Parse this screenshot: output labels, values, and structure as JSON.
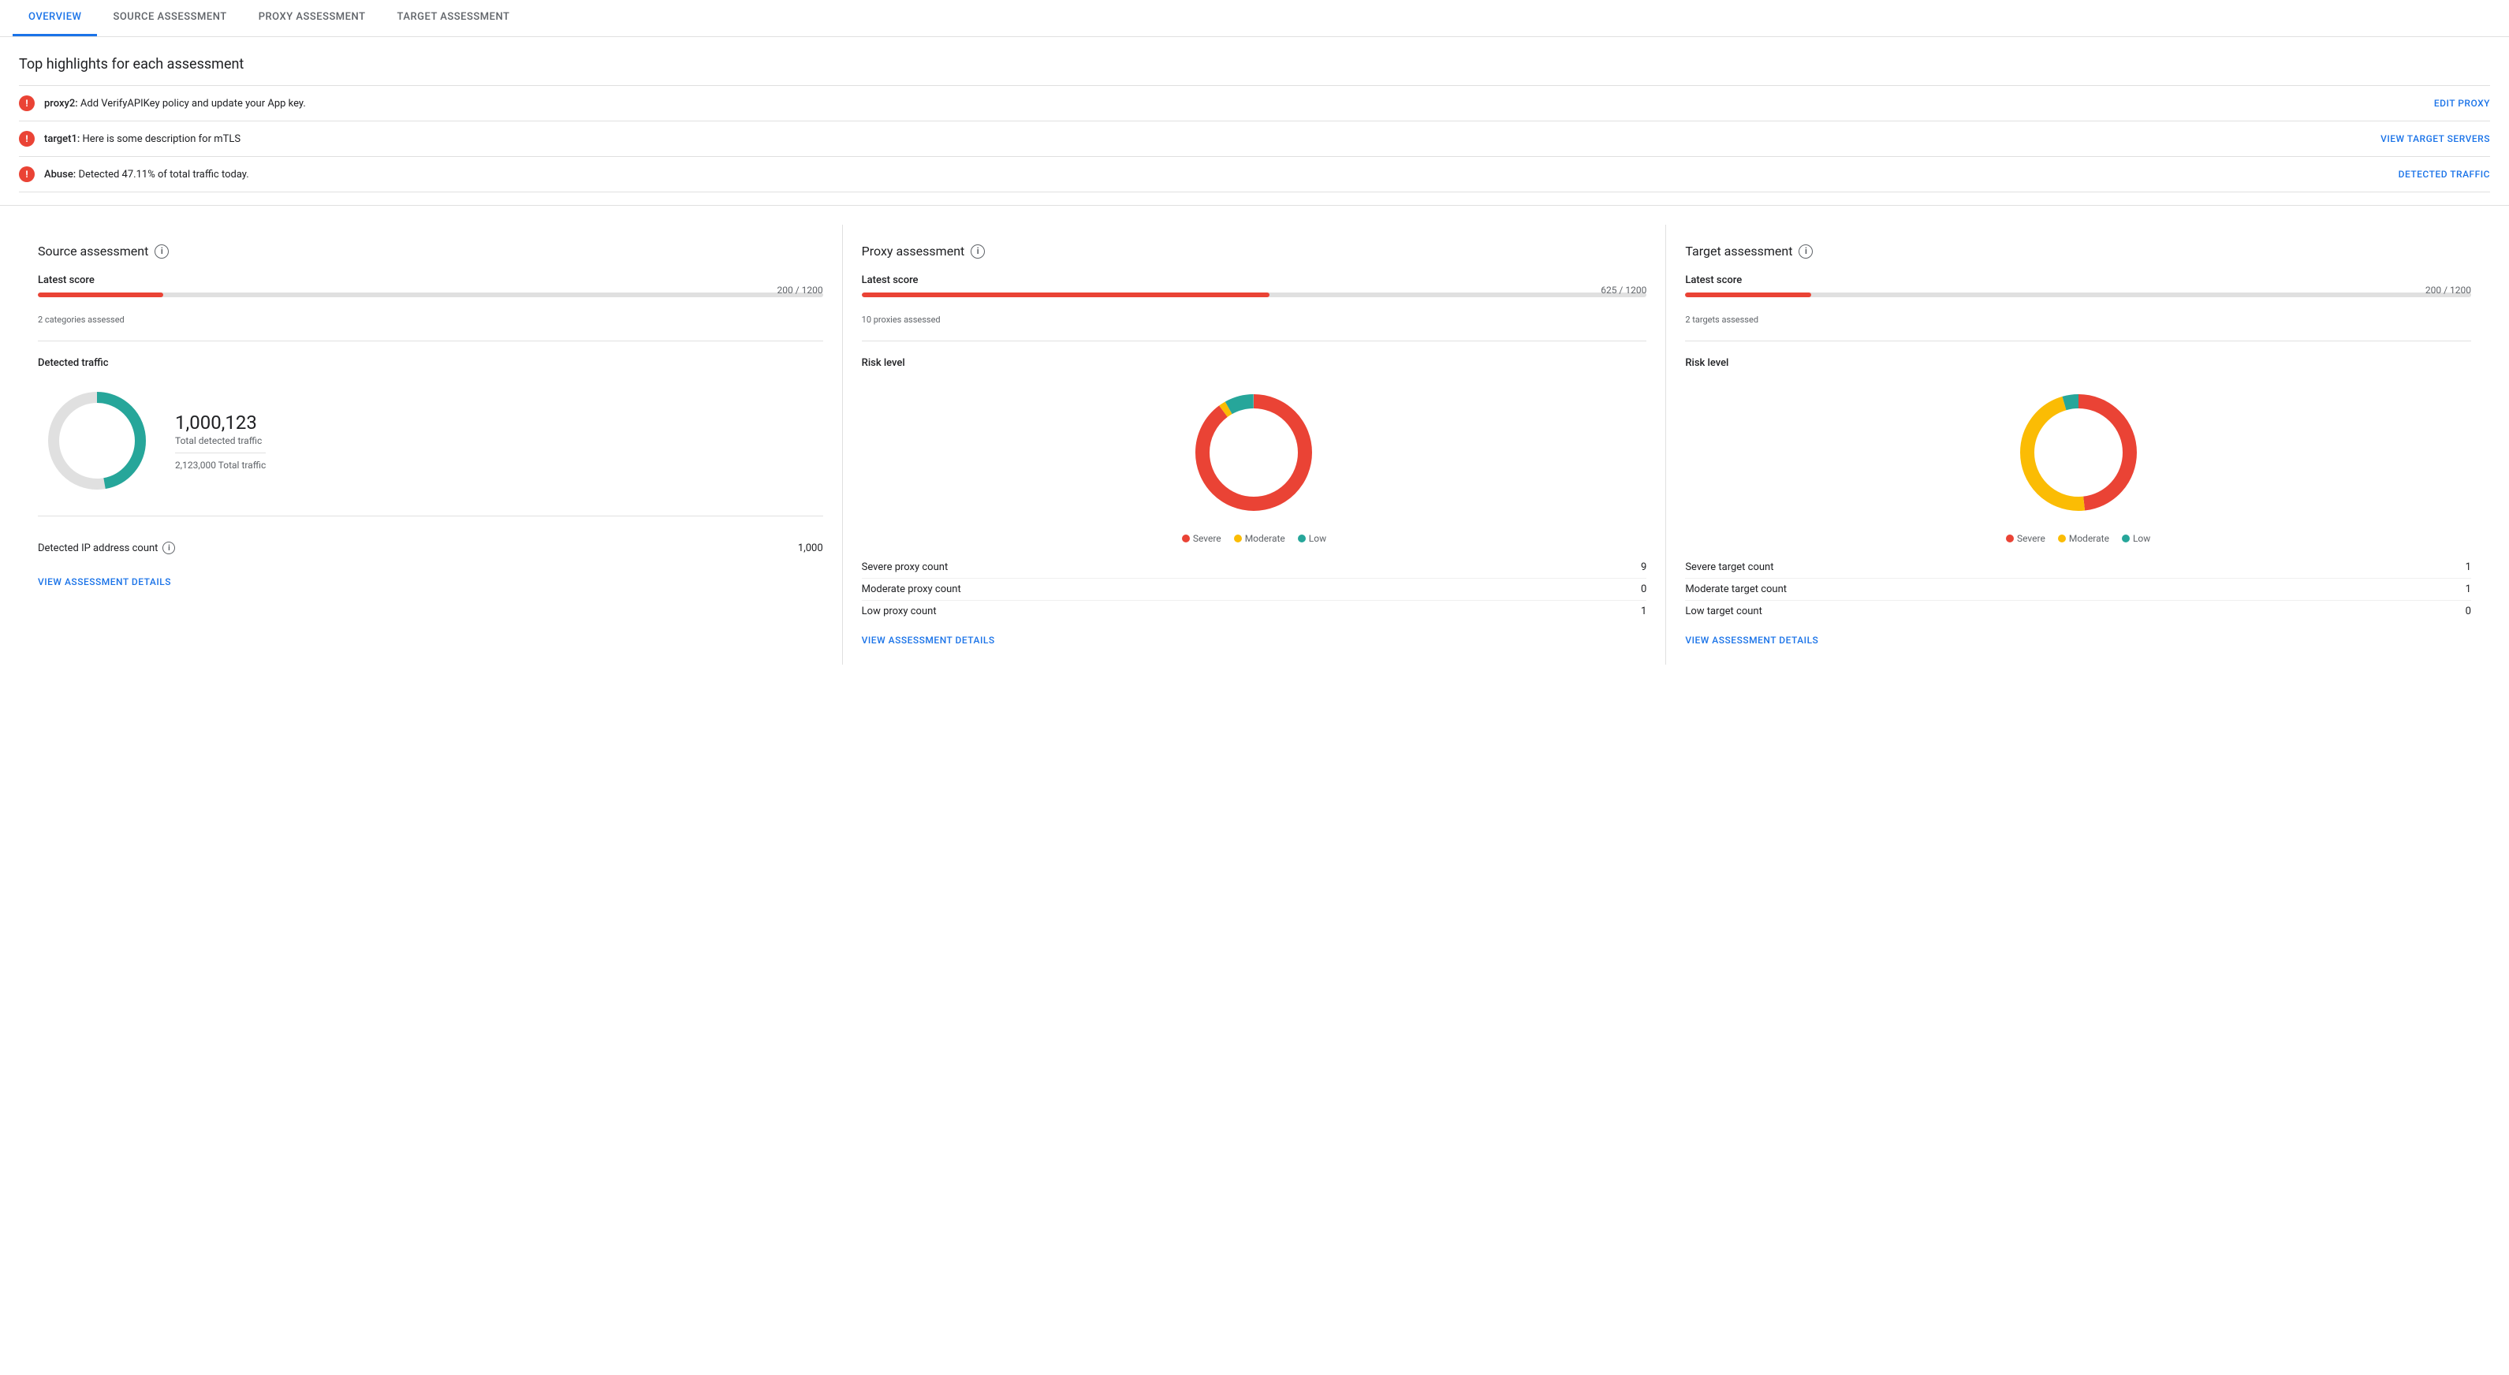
{
  "tabs": [
    {
      "id": "overview",
      "label": "OVERVIEW",
      "active": true
    },
    {
      "id": "source",
      "label": "SOURCE ASSESSMENT",
      "active": false
    },
    {
      "id": "proxy",
      "label": "PROXY ASSESSMENT",
      "active": false
    },
    {
      "id": "target",
      "label": "TARGET ASSESSMENT",
      "active": false
    }
  ],
  "highlights": {
    "title": "Top highlights for each assessment",
    "rows": [
      {
        "text_bold": "proxy2:",
        "text_rest": " Add VerifyAPIKey policy and update your App key.",
        "link_label": "EDIT PROXY"
      },
      {
        "text_bold": "target1:",
        "text_rest": " Here is some description for mTLS",
        "link_label": "VIEW TARGET SERVERS"
      },
      {
        "text_bold": "Abuse:",
        "text_rest": " Detected 47.11% of total traffic today.",
        "link_label": "DETECTED TRAFFIC"
      }
    ]
  },
  "source_card": {
    "title": "Source assessment",
    "latest_score_label": "Latest score",
    "score_value": "200 / 1200",
    "score_percent": 16,
    "score_bar_color": "#ea4335",
    "score_subtitle": "2 categories assessed",
    "detected_traffic_label": "Detected traffic",
    "traffic_count": "1,000,123",
    "traffic_desc": "Total detected traffic",
    "traffic_total": "2,123,000 Total traffic",
    "ip_label": "Detected IP address count",
    "ip_value": "1,000",
    "view_link": "VIEW ASSESSMENT DETAILS",
    "donut": {
      "detected_percent": 47,
      "detected_color": "#26a69a",
      "rest_color": "#e0e0e0"
    }
  },
  "proxy_card": {
    "title": "Proxy assessment",
    "latest_score_label": "Latest score",
    "score_value": "625 / 1200",
    "score_percent": 52,
    "score_bar_color": "#ea4335",
    "score_subtitle": "10 proxies assessed",
    "risk_level_label": "Risk level",
    "view_link": "VIEW ASSESSMENT DETAILS",
    "donut": {
      "severe_percent": 90,
      "moderate_percent": 2,
      "low_percent": 8,
      "severe_color": "#ea4335",
      "moderate_color": "#fbbc04",
      "low_color": "#26a69a"
    },
    "legend": [
      {
        "label": "Severe",
        "color": "#ea4335"
      },
      {
        "label": "Moderate",
        "color": "#fbbc04"
      },
      {
        "label": "Low",
        "color": "#26a69a"
      }
    ],
    "risk_counts": [
      {
        "label": "Severe proxy count",
        "value": "9"
      },
      {
        "label": "Moderate proxy count",
        "value": "0"
      },
      {
        "label": "Low proxy count",
        "value": "1"
      }
    ]
  },
  "target_card": {
    "title": "Target assessment",
    "latest_score_label": "Latest score",
    "score_value": "200 / 1200",
    "score_percent": 16,
    "score_bar_color": "#ea4335",
    "score_subtitle": "2 targets assessed",
    "risk_level_label": "Risk level",
    "view_link": "VIEW ASSESSMENT DETAILS",
    "donut": {
      "severe_percent": 48,
      "moderate_percent": 47,
      "low_percent": 5,
      "severe_color": "#ea4335",
      "moderate_color": "#fbbc04",
      "low_color": "#26a69a"
    },
    "legend": [
      {
        "label": "Severe",
        "color": "#ea4335"
      },
      {
        "label": "Moderate",
        "color": "#fbbc04"
      },
      {
        "label": "Low",
        "color": "#26a69a"
      }
    ],
    "risk_counts": [
      {
        "label": "Severe target count",
        "value": "1"
      },
      {
        "label": "Moderate target count",
        "value": "1"
      },
      {
        "label": "Low target count",
        "value": "0"
      }
    ]
  },
  "icons": {
    "info": "ⓘ",
    "error": "!"
  }
}
